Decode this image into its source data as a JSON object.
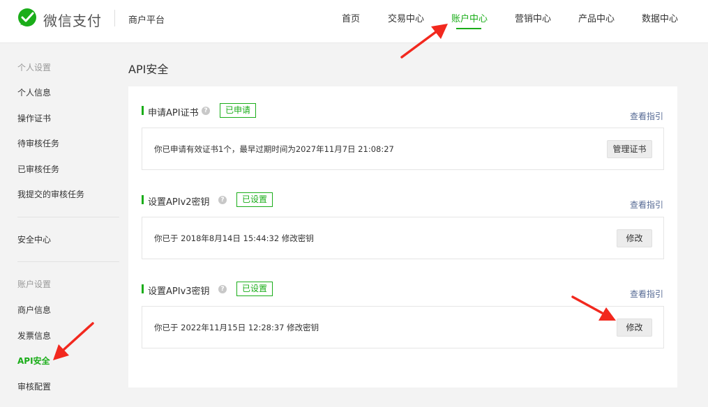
{
  "header": {
    "brand": "微信支付",
    "platform": "商户平台",
    "nav": [
      "首页",
      "交易中心",
      "账户中心",
      "营销中心",
      "产品中心",
      "数据中心"
    ],
    "active_nav": "账户中心",
    "accent": "#1aad19"
  },
  "sidebar": {
    "group_personal": "个人设置",
    "personal_items": [
      "个人信息",
      "操作证书",
      "待审核任务",
      "已审核任务",
      "我提交的审核任务"
    ],
    "security_center": "安全中心",
    "group_account": "账户设置",
    "account_items": [
      "商户信息",
      "发票信息",
      "API安全",
      "审核配置"
    ],
    "active_item": "API安全"
  },
  "main": {
    "title": "API安全",
    "sections": [
      {
        "title": "申请API证书",
        "badge": "已申请",
        "guide": "查看指引",
        "desc": "你已申请有效证书1个，最早过期时间为2027年11月7日 21:08:27",
        "button": "管理证书"
      },
      {
        "title": "设置APIv2密钥",
        "badge": "已设置",
        "guide": "查看指引",
        "desc": "你已于 2018年8月14日 15:44:32 修改密钥",
        "button": "修改"
      },
      {
        "title": "设置APIv3密钥",
        "badge": "已设置",
        "guide": "查看指引",
        "desc": "你已于 2022年11月15日 12:28:37 修改密钥",
        "button": "修改"
      }
    ]
  },
  "icons": {
    "logo": "wechat-pay-logo-icon",
    "help": "question-mark-icon",
    "annotation": "red-arrow-icon"
  },
  "colors": {
    "accent_green": "#1aad19",
    "link_blue": "#576b95",
    "annotation_red": "#f2281e"
  }
}
